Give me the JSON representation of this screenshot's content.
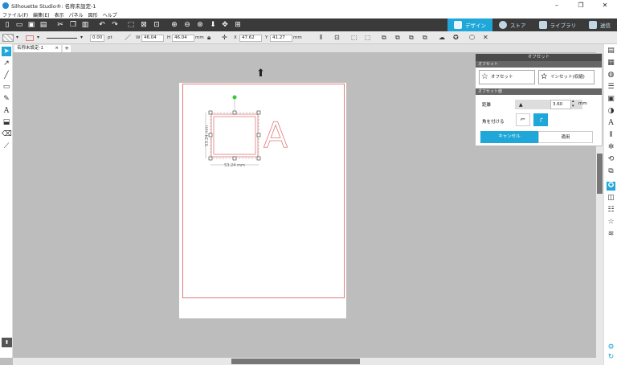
{
  "window": {
    "title": "Silhouette Studio®: 名称未設定-1",
    "minimize": "–",
    "restore": "❐",
    "close": "✕"
  },
  "menu": [
    "ファイル(F)",
    "編集(E)",
    "表示",
    "パネル",
    "図形",
    "ヘルプ"
  ],
  "mode_tabs": [
    {
      "label": "デザイン",
      "active": true
    },
    {
      "label": "ストア",
      "active": false
    },
    {
      "label": "ライブラリ",
      "active": false
    },
    {
      "label": "送信",
      "active": false
    }
  ],
  "line_toolbar": {
    "line_width": "0.00",
    "line_unit": "pt"
  },
  "dimensions": {
    "w_label": "W",
    "w_value": "46.04",
    "h_label": "H",
    "h_value": "46.04",
    "size_unit": "mm",
    "x_label": "X",
    "x_value": "47.62",
    "y_label": "Y",
    "y_value": "41.27",
    "pos_unit": "mm"
  },
  "doc_tab": {
    "label": "名称未設定-1",
    "close": "×",
    "add": "+"
  },
  "canvas": {
    "height_dim": "53.24 mm",
    "width_dim": "53.24 mm",
    "letter": "A",
    "cut_color": "#e07b7b",
    "accent": "#1ea7d8"
  },
  "offset_panel": {
    "title": "オフセット",
    "section_offset": "オフセット",
    "offset_label": "オフセット",
    "inset_label": "インセット(収縮)",
    "section_value": "オフセット値",
    "distance_label": "距離",
    "distance_value": "3.60",
    "distance_unit": "mm",
    "corner_label": "角を付ける",
    "cancel_label": "キャンセル",
    "apply_label": "適用"
  },
  "left_tools": [
    "select-tool-icon",
    "node-edit-icon",
    "line-tool-icon",
    "rectangle-tool-icon",
    "pen-tool-icon",
    "text-tool-icon",
    "fill-tool-icon",
    "eraser-tool-icon",
    "knife-tool-icon"
  ],
  "right_tools": [
    "page-setup-icon",
    "fill-color-icon",
    "line-color-icon",
    "line-style-icon",
    "fill-pattern-icon",
    "gradient-icon",
    "text-style-icon",
    "align-icon",
    "replicate-icon",
    "transform-icon",
    "offset-icon",
    "trace-icon",
    "modify-icon",
    "shapes-icon",
    "sketch-icon"
  ]
}
